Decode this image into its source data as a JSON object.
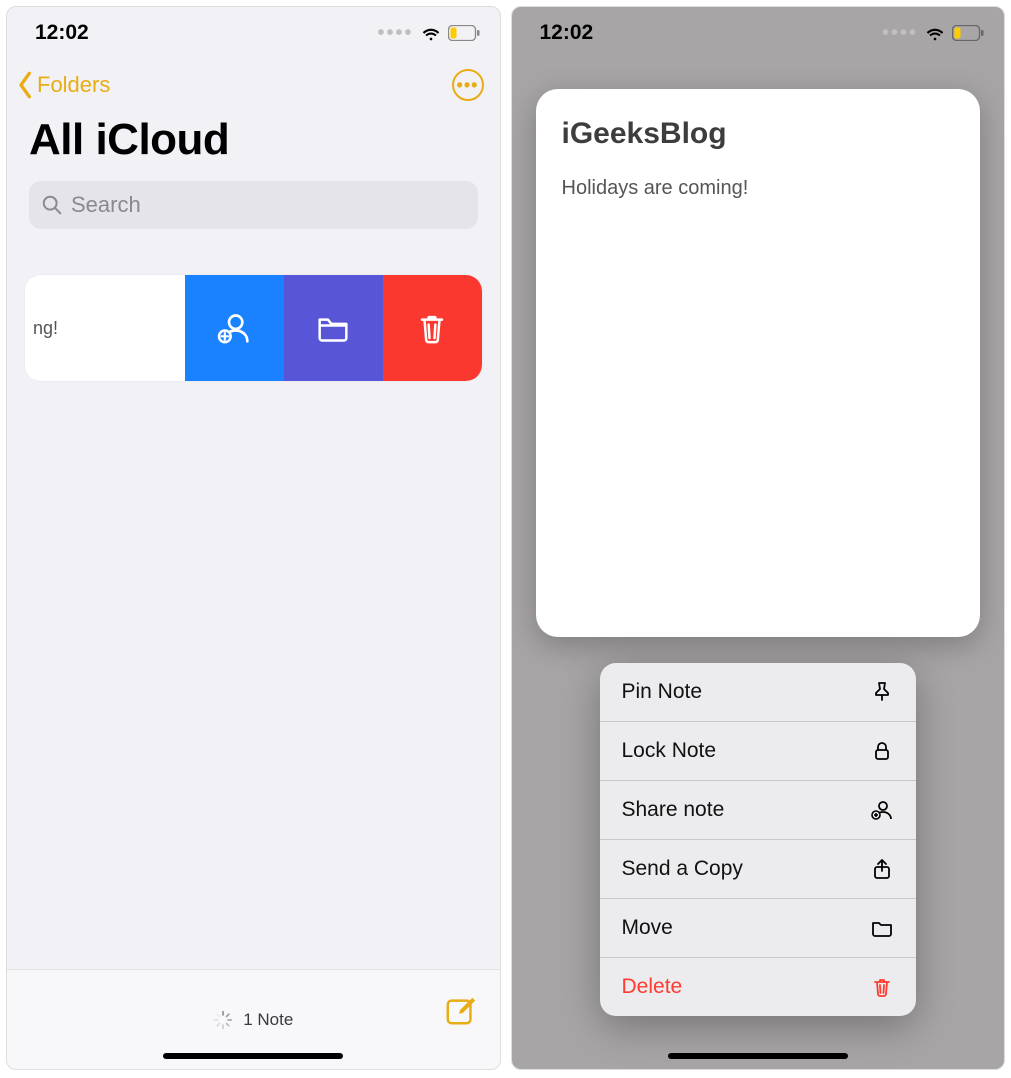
{
  "left": {
    "status": {
      "time": "12:02"
    },
    "nav": {
      "back_label": "Folders"
    },
    "title": "All iCloud",
    "search": {
      "placeholder": "Search"
    },
    "note_row": {
      "visible_text": "ng!"
    },
    "swipe_actions": {
      "share": "share-add-person",
      "move": "folder",
      "delete": "trash"
    },
    "footer": {
      "count_text": "1 Note"
    }
  },
  "right": {
    "status": {
      "time": "12:02"
    },
    "preview": {
      "title": "iGeeksBlog",
      "body": "Holidays are coming!"
    },
    "menu": {
      "pin": "Pin Note",
      "lock": "Lock Note",
      "share": "Share note",
      "send_copy": "Send a Copy",
      "move": "Move",
      "delete": "Delete"
    }
  }
}
